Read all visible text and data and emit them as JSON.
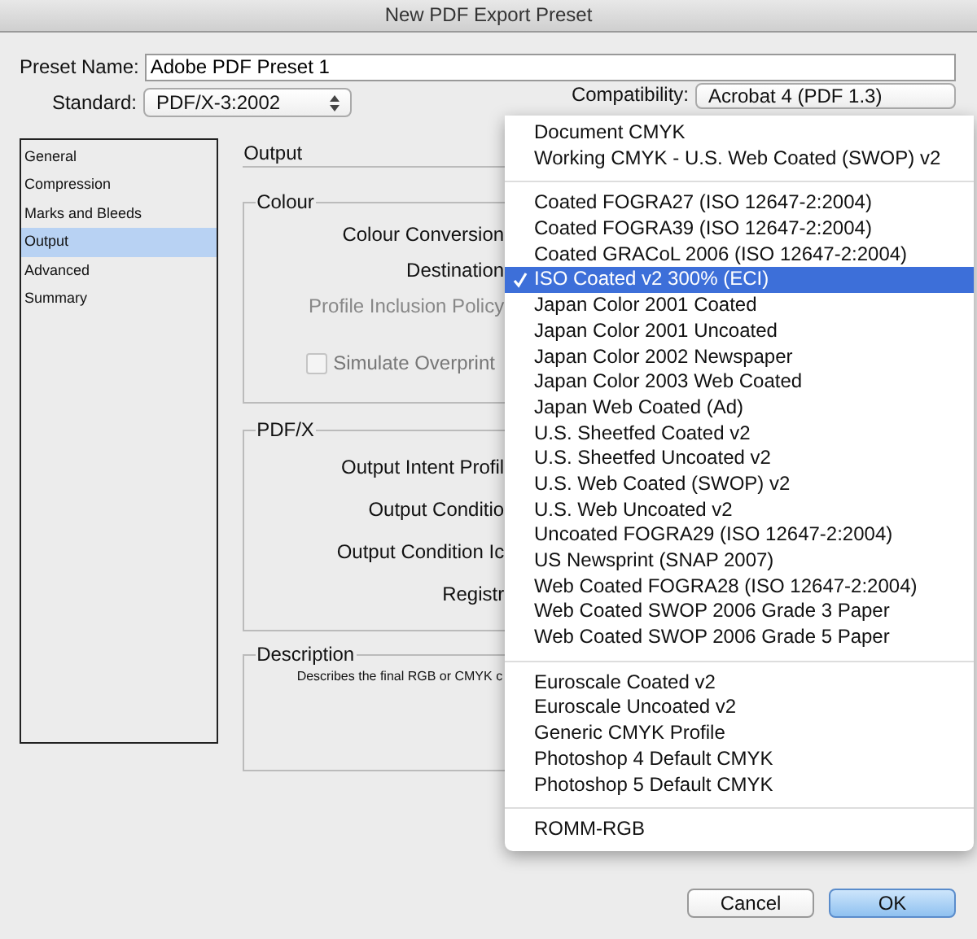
{
  "window": {
    "title": "New PDF Export Preset"
  },
  "preset_name": {
    "label": "Preset Name:",
    "value": "Adobe PDF Preset 1"
  },
  "standard": {
    "label": "Standard:",
    "value": "PDF/X-3:2002"
  },
  "compatibility": {
    "label": "Compatibility:",
    "value": "Acrobat 4 (PDF 1.3)"
  },
  "sidebar": {
    "items": [
      {
        "label": "General",
        "selected": false
      },
      {
        "label": "Compression",
        "selected": false
      },
      {
        "label": "Marks and Bleeds",
        "selected": false
      },
      {
        "label": "Output",
        "selected": true
      },
      {
        "label": "Advanced",
        "selected": false
      },
      {
        "label": "Summary",
        "selected": false
      }
    ]
  },
  "section_title": "Output",
  "colour_group": {
    "title": "Colour",
    "rows": [
      {
        "label": "Colour Conversion",
        "disabled": false
      },
      {
        "label": "Destination",
        "disabled": false
      },
      {
        "label": "Profile Inclusion Policy",
        "disabled": true
      }
    ],
    "checkbox": {
      "label": "Simulate Overprint",
      "checked": false,
      "disabled": true
    }
  },
  "pdfx_group": {
    "title": "PDF/X",
    "rows": [
      "Output Intent Profil",
      "Output Conditio",
      "Output Condition Ic",
      "Registr"
    ]
  },
  "description_group": {
    "title": "Description",
    "text": "Describes the final RGB or CMYK c"
  },
  "menu": {
    "groups": [
      [
        {
          "label": "Document CMYK",
          "selected": false
        },
        {
          "label": "Working CMYK - U.S. Web Coated (SWOP) v2",
          "selected": false
        }
      ],
      [
        {
          "label": "Coated FOGRA27 (ISO 12647-2:2004)",
          "selected": false
        },
        {
          "label": "Coated FOGRA39 (ISO 12647-2:2004)",
          "selected": false
        },
        {
          "label": "Coated GRACoL 2006 (ISO 12647-2:2004)",
          "selected": false
        },
        {
          "label": "ISO Coated v2 300% (ECI)",
          "selected": true
        },
        {
          "label": "Japan Color 2001 Coated",
          "selected": false
        },
        {
          "label": "Japan Color 2001 Uncoated",
          "selected": false
        },
        {
          "label": "Japan Color 2002 Newspaper",
          "selected": false
        },
        {
          "label": "Japan Color 2003 Web Coated",
          "selected": false
        },
        {
          "label": "Japan Web Coated (Ad)",
          "selected": false
        },
        {
          "label": "U.S. Sheetfed Coated v2",
          "selected": false
        },
        {
          "label": "U.S. Sheetfed Uncoated v2",
          "selected": false
        },
        {
          "label": "U.S. Web Coated (SWOP) v2",
          "selected": false
        },
        {
          "label": "U.S. Web Uncoated v2",
          "selected": false
        },
        {
          "label": "Uncoated FOGRA29 (ISO 12647-2:2004)",
          "selected": false
        },
        {
          "label": "US Newsprint (SNAP 2007)",
          "selected": false
        },
        {
          "label": "Web Coated FOGRA28 (ISO 12647-2:2004)",
          "selected": false
        },
        {
          "label": "Web Coated SWOP 2006 Grade 3 Paper",
          "selected": false
        },
        {
          "label": "Web Coated SWOP 2006 Grade 5 Paper",
          "selected": false
        }
      ],
      [
        {
          "label": "Euroscale Coated v2",
          "selected": false
        },
        {
          "label": "Euroscale Uncoated v2",
          "selected": false
        },
        {
          "label": "Generic CMYK Profile",
          "selected": false
        },
        {
          "label": "Photoshop 4 Default CMYK",
          "selected": false
        },
        {
          "label": "Photoshop 5 Default CMYK",
          "selected": false
        }
      ],
      [
        {
          "label": "ROMM-RGB",
          "selected": false
        }
      ]
    ]
  },
  "buttons": [
    {
      "label": "Cancel",
      "default": false
    },
    {
      "label": "OK",
      "default": true
    }
  ]
}
